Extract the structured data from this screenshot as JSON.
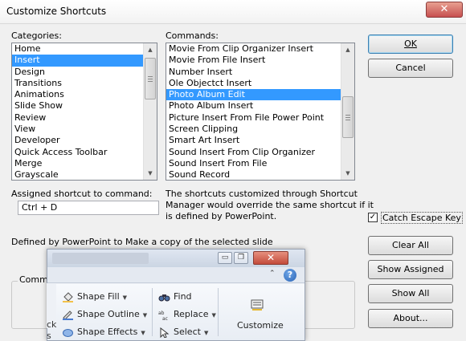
{
  "dialog": {
    "title": "Customize Shortcuts",
    "close_glyph": "✕"
  },
  "categories": {
    "label": "Categories:",
    "items": [
      "Home",
      "Insert",
      "Design",
      "Transitions",
      "Animations",
      "Slide Show",
      "Review",
      "View",
      "Developer",
      "Quick  Access  Toolbar",
      "Merge",
      "Grayscale"
    ],
    "selected": "Insert"
  },
  "commands": {
    "label": "Commands:",
    "items": [
      "Movie From Clip Organizer Insert",
      "Movie From File Insert",
      "Number Insert",
      "Ole Objectct Insert",
      "Photo Album Edit",
      "Photo Album Insert",
      "Picture Insert From File Power Point",
      "Screen Clipping",
      "Smart Art Insert",
      "Sound Insert From Clip Organizer",
      "Sound Insert From File",
      "Sound Record"
    ],
    "selected": "Photo Album Edit"
  },
  "assigned": {
    "label": "Assigned shortcut to command:",
    "value": "Ctrl + D"
  },
  "note": {
    "line1": "The shortcuts customized through Shortcut",
    "line2": "Manager would override the same shortcut if it",
    "line3": "is defined by PowerPoint."
  },
  "defined_by": "Defined by PowerPoint to Make a copy of the selected slide",
  "comment_group_label": "Comm",
  "buttons": {
    "ok": "OK",
    "cancel": "Cancel",
    "clear_all": "Clear All",
    "show_assigned": "Show Assigned",
    "show_all": "Show All",
    "about": "About..."
  },
  "catch_escape": {
    "label": "Catch Escape Key",
    "checked": true,
    "check_glyph": "✓"
  },
  "overlay": {
    "min_glyph": "▭",
    "max_glyph": "❐",
    "close_glyph": "✕",
    "collapse_glyph": "⌃",
    "help_glyph": "?",
    "shape_fill": "Shape Fill",
    "shape_outline": "Shape Outline",
    "shape_effects": "Shape Effects",
    "find": "Find",
    "replace": "Replace",
    "select": "Select",
    "customize": "Customize",
    "frag1": "ck",
    "frag2": "s"
  },
  "colors": {
    "selection": "#3399ff",
    "dialog_bg": "#f0f0f0",
    "close_red": "#c75050"
  }
}
